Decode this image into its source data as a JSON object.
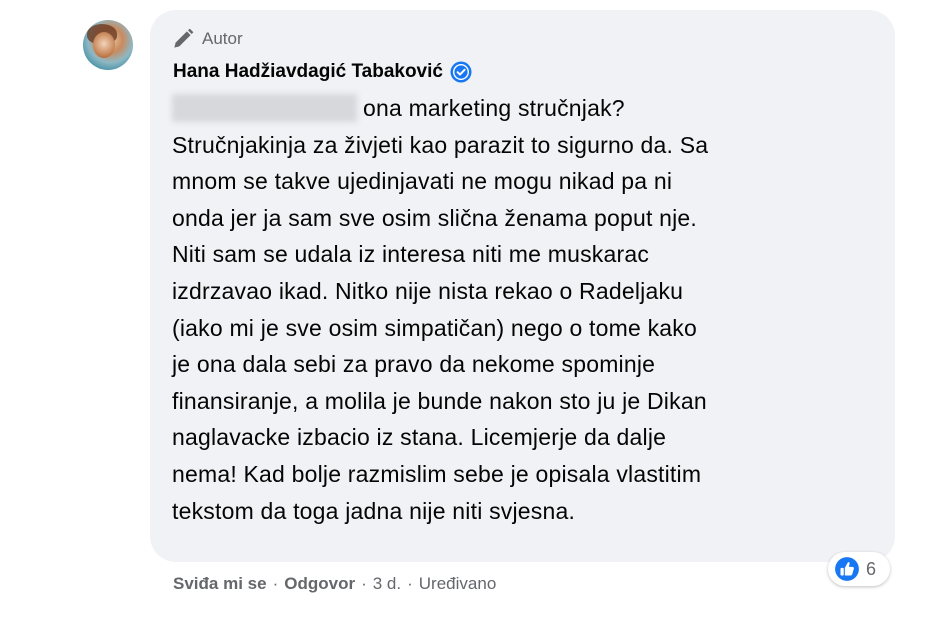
{
  "comment": {
    "author_badge": "Autor",
    "author_name": "Hana Hadžiavdagić Tabaković",
    "text_first_line": "ona marketing stručnjak?",
    "text_lines": [
      "Stručnjakinja za živjeti kao parazit to sigurno da. Sa",
      "mnom se takve ujedinjavati ne mogu nikad pa ni",
      "onda jer ja sam sve osim slična ženama poput nje.",
      "Niti sam se udala iz interesa niti me muskarac",
      "izdrzavao ikad. Nitko nije nista rekao o Radeljaku",
      "(iako mi je sve osim simpatičan) nego o tome kako",
      "je ona dala sebi za pravo da nekome spominje",
      "finansiranje, a molila je bunde nakon sto ju je Dikan",
      "naglavacke izbacio iz stana. Licemjerje da dalje",
      "nema! Kad bolje razmislim sebe je opisala vlastitim",
      "tekstom da toga jadna nije niti svjesna."
    ],
    "reaction_count": "6",
    "actions": {
      "like": "Sviđa mi se",
      "reply": "Odgovor",
      "time": "3 d.",
      "edited": "Uređivano",
      "separator": "·"
    }
  },
  "colors": {
    "bubble_bg": "#f0f2f5",
    "secondary_text": "#65676b",
    "primary_text": "#050505",
    "verified_blue": "#1877f2",
    "like_blue": "#1877f2"
  },
  "icons": {
    "author": "pen-icon",
    "verified": "verified-badge-icon",
    "reaction": "like-thumb-icon"
  }
}
